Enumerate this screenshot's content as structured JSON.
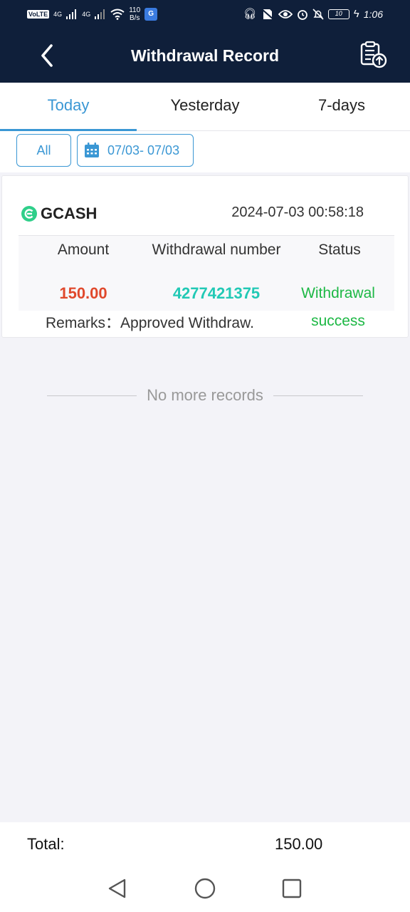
{
  "status_bar": {
    "volte": "VoLTE",
    "network_1": "4G",
    "network_2": "4G",
    "speed_value": "110",
    "speed_unit": "B/s",
    "battery": "10",
    "time": "1:06"
  },
  "header": {
    "title": "Withdrawal Record"
  },
  "tabs": [
    {
      "label": "Today",
      "active": true
    },
    {
      "label": "Yesterday",
      "active": false
    },
    {
      "label": "7-days",
      "active": false
    }
  ],
  "filters": {
    "type_label": "All",
    "date_range": "07/03- 07/03"
  },
  "records": [
    {
      "provider": "GCASH",
      "datetime": "2024-07-03 00:58:18",
      "columns": {
        "amount": "Amount",
        "number": "Withdrawal number",
        "status": "Status"
      },
      "amount": "150.00",
      "withdrawal_number": "4277421375",
      "status_line1": "Withdrawal",
      "status_line2": "success",
      "remarks_label": "Remarks：",
      "remarks_value": "Approved Withdraw."
    }
  ],
  "no_more": "No more records",
  "footer": {
    "total_label": "Total:",
    "total_value": "150.00"
  },
  "colors": {
    "header_bg": "#0f1f3a",
    "accent": "#3a97d4",
    "amount": "#e0492c",
    "number": "#22c9b5",
    "success": "#1db845"
  },
  "icons": {
    "back": "chevron-left-icon",
    "upload": "clipboard-upload-icon",
    "calendar": "calendar-icon",
    "provider": "gcash-logo-icon"
  }
}
